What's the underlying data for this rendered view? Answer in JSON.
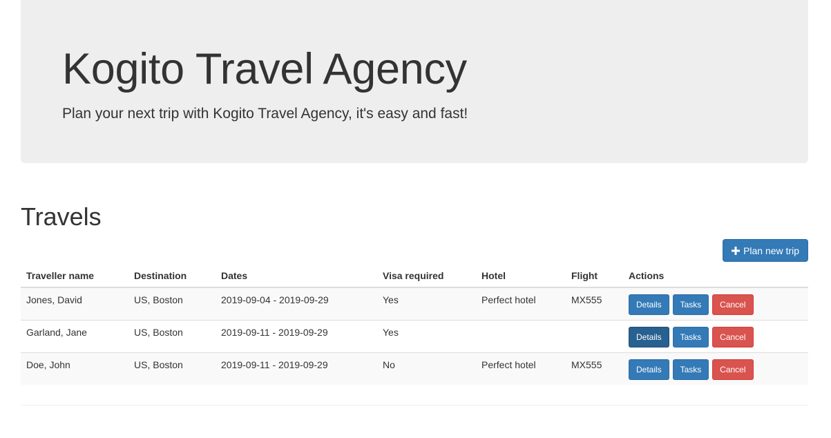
{
  "header": {
    "title": "Kogito Travel Agency",
    "subtitle": "Plan your next trip with Kogito Travel Agency, it's easy and fast!"
  },
  "travels": {
    "title": "Travels",
    "plan_button_label": "Plan new trip",
    "plan_button_icon": "plus-icon",
    "columns": [
      "Traveller name",
      "Destination",
      "Dates",
      "Visa required",
      "Hotel",
      "Flight",
      "Actions"
    ],
    "rows": [
      {
        "traveller": "Jones, David",
        "destination": "US, Boston",
        "dates": "2019-09-04 - 2019-09-29",
        "visa": "Yes",
        "hotel": "Perfect hotel",
        "flight": "MX555"
      },
      {
        "traveller": "Garland, Jane",
        "destination": "US, Boston",
        "dates": "2019-09-11 - 2019-09-29",
        "visa": "Yes",
        "hotel": "",
        "flight": ""
      },
      {
        "traveller": "Doe, John",
        "destination": "US, Boston",
        "dates": "2019-09-11 - 2019-09-29",
        "visa": "No",
        "hotel": "Perfect hotel",
        "flight": "MX555"
      }
    ],
    "actions": {
      "details": "Details",
      "tasks": "Tasks",
      "cancel": "Cancel"
    }
  },
  "colors": {
    "primary": "#337ab7",
    "danger": "#d9534f",
    "jumbotron_bg": "#eeeeee"
  }
}
